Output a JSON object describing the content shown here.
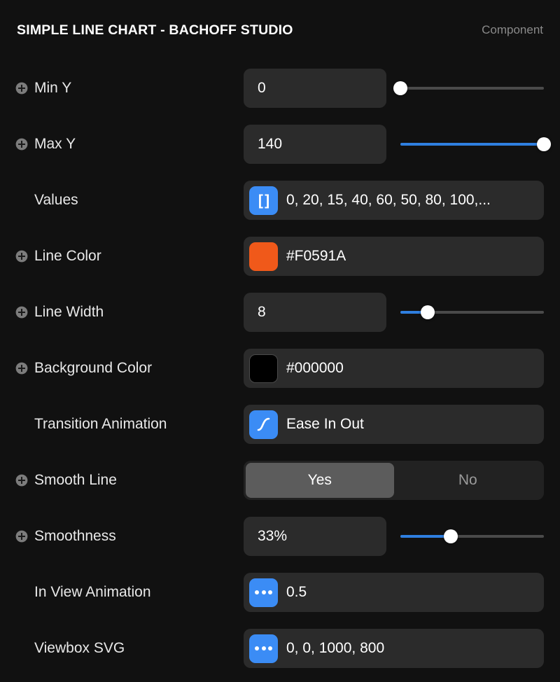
{
  "header": {
    "title": "SIMPLE LINE CHART - BACHOFF STUDIO",
    "kind": "Component"
  },
  "colors": {
    "accent_blue": "#3b8cf5",
    "slider_blue": "#2f7fe0",
    "line_color": "#F0591A",
    "background_color": "#000000",
    "panel_bg": "#111111",
    "field_bg": "#2b2b2b"
  },
  "rows": [
    {
      "label": "Min Y",
      "has_plus": true,
      "control": "input-slider",
      "value": "0",
      "slider_percent": 0
    },
    {
      "label": "Max Y",
      "has_plus": true,
      "control": "input-slider",
      "value": "140",
      "slider_percent": 100
    },
    {
      "label": "Values",
      "has_plus": false,
      "control": "input-icon",
      "icon": "array-brackets-icon",
      "value": "0, 20, 15, 40, 60, 50, 80, 100,..."
    },
    {
      "label": "Line Color",
      "has_plus": true,
      "control": "input-swatch",
      "icon": "color-swatch-icon",
      "swatch": "#F0591A",
      "value": "#F0591A"
    },
    {
      "label": "Line Width",
      "has_plus": true,
      "control": "input-slider",
      "value": "8",
      "slider_percent": 19
    },
    {
      "label": "Background Color",
      "has_plus": true,
      "control": "input-swatch",
      "icon": "color-swatch-icon",
      "swatch": "#000000",
      "value": "#000000"
    },
    {
      "label": "Transition Animation",
      "has_plus": false,
      "control": "input-icon",
      "icon": "ease-in-out-curve-icon",
      "value": "Ease In Out"
    },
    {
      "label": "Smooth Line",
      "has_plus": true,
      "control": "segmented",
      "options": [
        "Yes",
        "No"
      ],
      "selected": "Yes"
    },
    {
      "label": "Smoothness",
      "has_plus": true,
      "control": "input-slider",
      "value": "33%",
      "slider_percent": 35
    },
    {
      "label": "In View Animation",
      "has_plus": false,
      "control": "input-icon",
      "icon": "ellipsis-icon",
      "value": "0.5"
    },
    {
      "label": "Viewbox SVG",
      "has_plus": false,
      "control": "input-icon",
      "icon": "ellipsis-icon",
      "value": "0, 0, 1000, 800"
    }
  ]
}
